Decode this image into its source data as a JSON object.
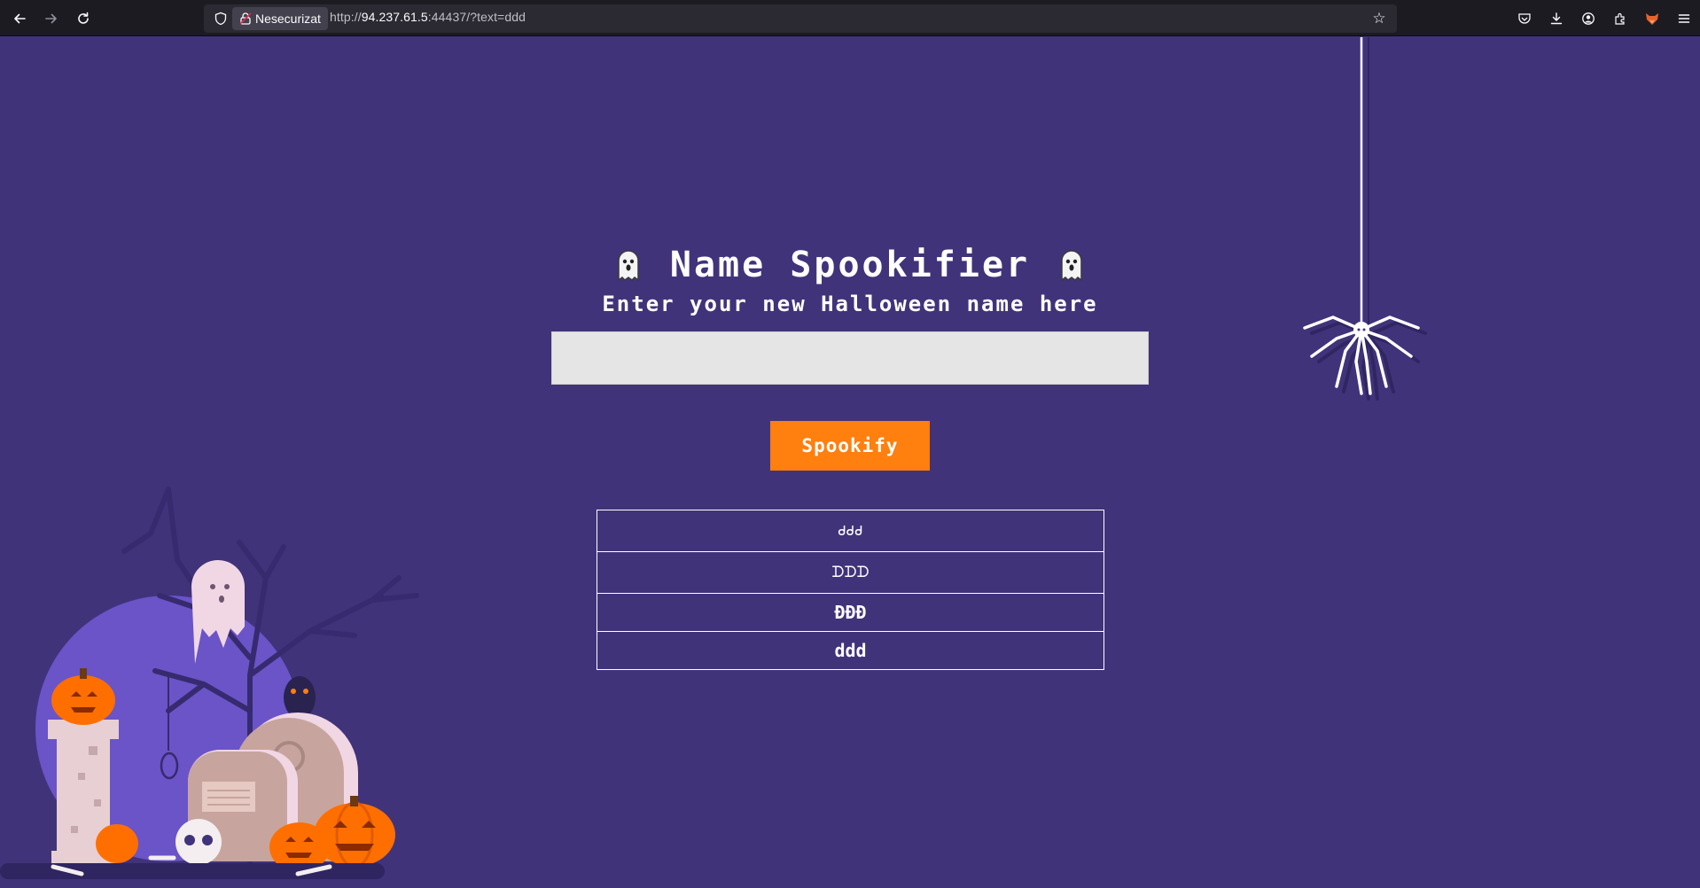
{
  "browser": {
    "connection_label": "Nesecurizat",
    "url_prefix": "http://",
    "url_host": "94.237.61.5",
    "url_rest": ":44437/?text=ddd"
  },
  "page": {
    "title": "Name Spookifier",
    "subtitle": "Enter your new Halloween name here",
    "input_value": "",
    "button_label": "Spookify",
    "results": [
      "ᑯᑯᑯ",
      "ᗪᗪᗪ",
      "ÐÐÐ",
      "ddd"
    ]
  },
  "colors": {
    "background": "#41337a",
    "button": "#ff7f0f",
    "input": "#e5e5e5",
    "text": "#ffffff"
  }
}
